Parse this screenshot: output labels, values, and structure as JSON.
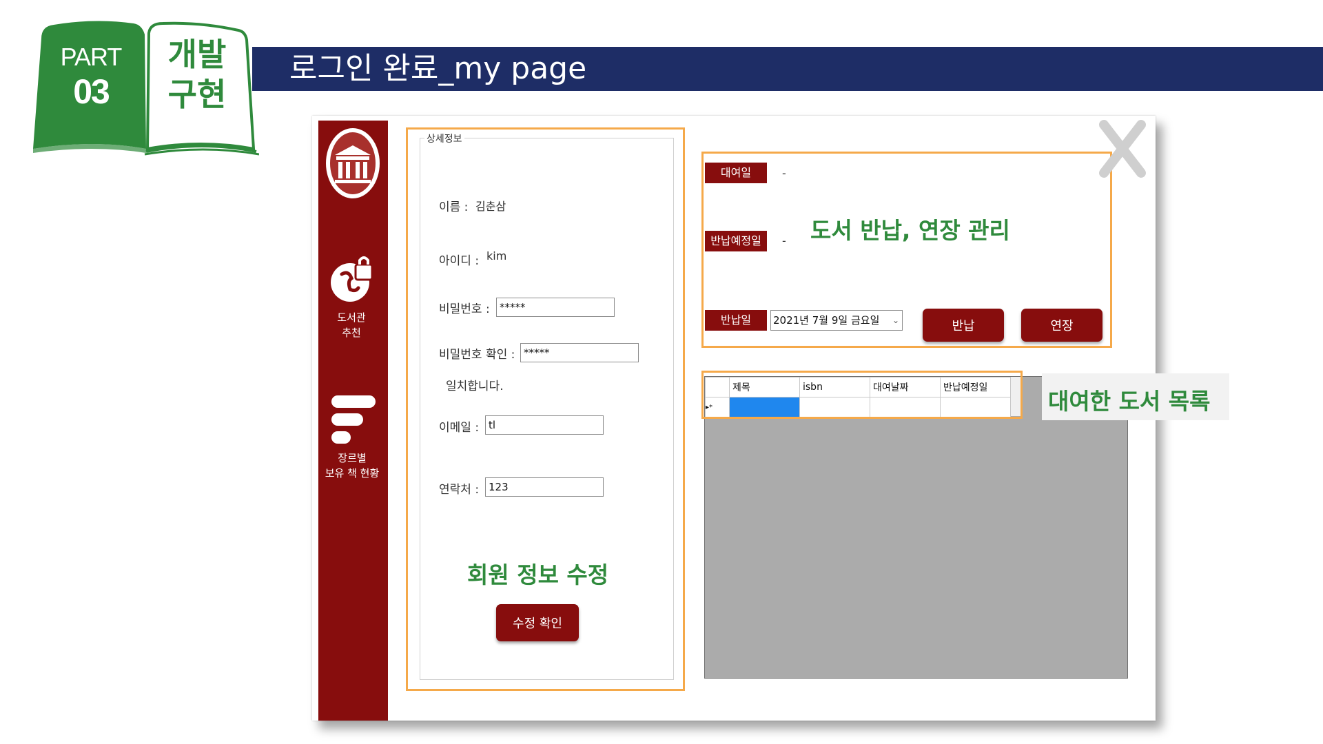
{
  "header": {
    "part_label": "PART",
    "part_number": "03",
    "section": "개발\n구현",
    "title": "로그인 완료_my page"
  },
  "sidebar": {
    "items": [
      {
        "icon": "library-building-icon",
        "label": ""
      },
      {
        "icon": "library-recommend-icon",
        "label": "도서관\n추천"
      },
      {
        "icon": "genre-bars-icon",
        "label": "장르별\n보유 책 현황"
      }
    ]
  },
  "details": {
    "legend": "상세정보",
    "name_label": "이름 :",
    "name_value": "김춘삼",
    "id_label": "아이디 :",
    "id_value": "kim",
    "password_label": "비밀번호 :",
    "password_value": "*****",
    "password_confirm_label": "비밀번호 확인 :",
    "password_confirm_value": "*****",
    "match_message": "일치합니다.",
    "email_label": "이메일 :",
    "email_value": "tl",
    "phone_label": "연락처 :",
    "phone_value": "123",
    "submit_label": "수정 확인"
  },
  "rental": {
    "rent_date_label": "대여일",
    "rent_date_value": "-",
    "due_date_label": "반납예정일",
    "due_date_value": "-",
    "return_date_label": "반납일",
    "return_date_value": "2021년   7월   9일 금요일",
    "return_button": "반납",
    "extend_button": "연장"
  },
  "grid": {
    "columns": [
      "제목",
      "isbn",
      "대여날짜",
      "반납예정일"
    ],
    "new_row_marker": "▸*"
  },
  "annotations": {
    "member_edit": "회원 정보 수정",
    "return_manage": "도서 반납, 연장 관리",
    "rented_list": "대여한 도서 목록"
  },
  "colors": {
    "navy": "#1e2d66",
    "green": "#2f8a3c",
    "dark_red": "#870d0d",
    "orange": "#f5a94a",
    "selection_blue": "#1f87ee"
  }
}
